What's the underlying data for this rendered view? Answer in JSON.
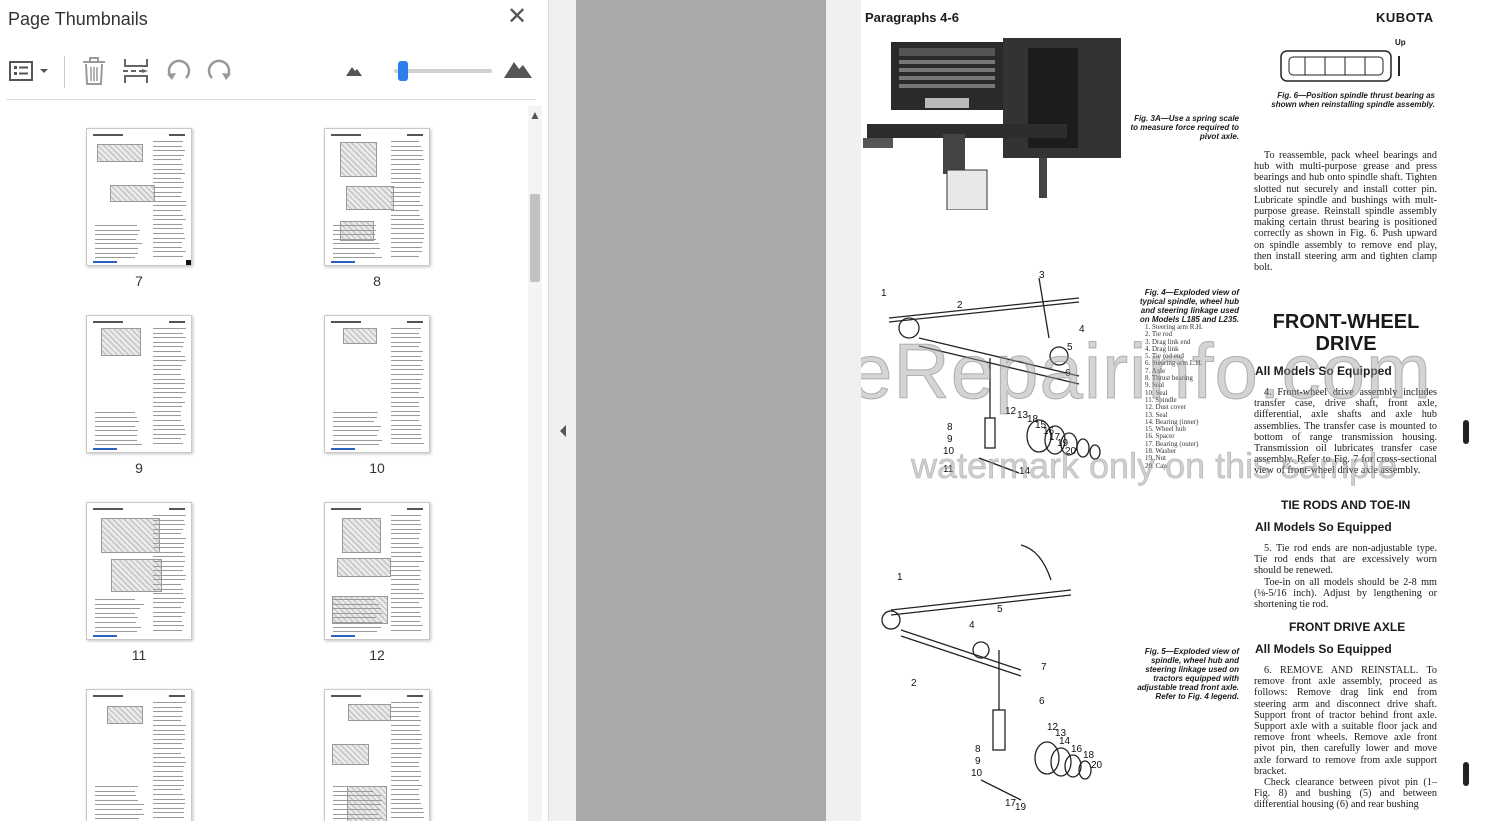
{
  "panel": {
    "title": "Page Thumbnails",
    "close_icon": "close-icon",
    "toolbar_icons": [
      "thumbnail-options-icon",
      "delete-page-icon",
      "extract-page-icon",
      "rotate-counterclockwise-icon",
      "rotate-clockwise-icon",
      "zoom-out-mountain-icon",
      "zoom-in-mountain-icon"
    ],
    "zoom_level_fraction": 0.05,
    "thumbnails": [
      "7",
      "8",
      "9",
      "10",
      "11",
      "12",
      "",
      ""
    ]
  },
  "document": {
    "header": "Paragraphs 4-6",
    "brand": "KUBOTA",
    "fig3a_caption": "Fig. 3A—Use a spring scale to measure force required to pivot axle.",
    "fig6_up": "Up",
    "fig6_caption": "Fig. 6—Position spindle thrust bearing as shown when reinstalling spindle assembly.",
    "reassemble_text": "To reassemble, pack wheel bearings and hub with multi-purpose grease and press bearings and hub onto spindle shaft. Tighten slotted nut securely and install cotter pin. Lubricate spindle and bushings with mult-purpose grease. Reinstall spindle assembly making certain thrust bearing is positioned correctly as shown in Fig. 6. Push upward on spindle assembly to remove end play, then install steering arm and tighten clamp bolt.",
    "fig4_caption": "Fig. 4—Exploded view of typical spindle, wheel hub and steering linkage used on Models L185 and L235.",
    "fig4_legend": [
      "1. Steering arm R.H.",
      "2. Tie rod",
      "3. Drag link end",
      "4. Drag link",
      "5. Tie rod end",
      "6. Steering arm L.H.",
      "7. Axle",
      "8. Thrust bearing",
      "9. Seal",
      "10. Seal",
      "11. Spindle",
      "12. Dust cover",
      "13. Seal",
      "14. Bearing (inner)",
      "15. Wheel hub",
      "16. Spacer",
      "17. Bearing (outer)",
      "18. Washer",
      "19. Nut",
      "20. Cap"
    ],
    "section_title": "FRONT-WHEEL DRIVE",
    "models_equipped": "All Models So Equipped",
    "para4_text": "4. Front-wheel drive assembly includes transfer case, drive shaft, front axle, differential, axle shafts and axle hub assemblies. The transfer case is mounted to bottom of range transmission housing. Transmission oil lubricates transfer case assembly. Refer to Fig. 7 for cross-sectional view of front-wheel drive axle assembly.",
    "tie_rods_heading": "TIE RODS AND TOE-IN",
    "models_equipped_2": "All Models So Equipped",
    "para5_text": "5. Tie rod ends are non-adjustable type. Tie rod ends that are excessively worn should be renewed.",
    "toe_in_text": "Toe-in on all models should be 2-8 mm (⅛-5/16 inch). Adjust by lengthening or shortening tie rod.",
    "front_axle_heading": "FRONT DRIVE AXLE",
    "models_equipped_3": "All Models So Equipped",
    "para6_text": "6. REMOVE AND REINSTALL. To remove front axle assembly, proceed as follows: Remove drag link end from steering arm and disconnect drive shaft. Support front of tractor behind front axle. Support axle with a suitable floor jack and remove front wheels. Remove axle front pivot pin, then carefully lower and move axle forward to remove from axle support bracket.",
    "check_text": "Check clearance between pivot pin (1–Fig. 8) and bushing (5) and between differential housing (6) and rear bushing",
    "fig5_caption": "Fig. 5—Exploded view of spindle, wheel hub and steering linkage used on tractors equipped with adjustable tread front axle. Refer to Fig. 4 legend.",
    "watermark_line1": "eRepairinfo.com",
    "watermark_line2": "watermark only on this sample"
  }
}
